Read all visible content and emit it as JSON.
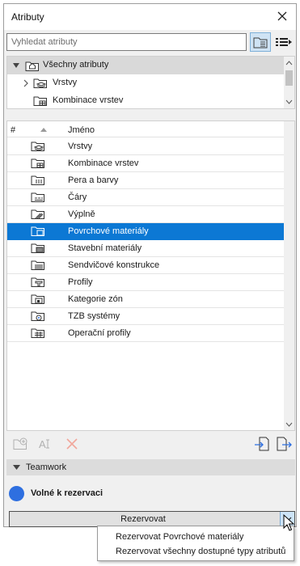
{
  "window": {
    "title": "Atributy"
  },
  "search": {
    "placeholder": "Vyhledat atributy"
  },
  "tree": {
    "items": [
      {
        "label": "Všechny atributy",
        "icon": "house-folder-icon"
      },
      {
        "label": "Vrstvy",
        "icon": "layers-icon"
      },
      {
        "label": "Kombinace vrstev",
        "icon": "layer-combination-icon"
      }
    ]
  },
  "table": {
    "headers": {
      "number": "#",
      "name": "Jméno"
    },
    "rows": [
      {
        "label": "Vrstvy",
        "icon": "layers-icon"
      },
      {
        "label": "Kombinace vrstev",
        "icon": "layer-combination-icon"
      },
      {
        "label": "Pera a barvy",
        "icon": "pens-colors-icon"
      },
      {
        "label": "Čáry",
        "icon": "lines-icon"
      },
      {
        "label": "Výplně",
        "icon": "fills-icon"
      },
      {
        "label": "Povrchové materiály",
        "icon": "surfaces-icon",
        "selected": true
      },
      {
        "label": "Stavební materiály",
        "icon": "building-materials-icon"
      },
      {
        "label": "Sendvičové konstrukce",
        "icon": "composites-icon"
      },
      {
        "label": "Profily",
        "icon": "profiles-icon"
      },
      {
        "label": "Kategorie zón",
        "icon": "zone-categories-icon"
      },
      {
        "label": "TZB systémy",
        "icon": "mep-systems-icon"
      },
      {
        "label": "Operační profily",
        "icon": "operation-profiles-icon"
      }
    ]
  },
  "teamwork": {
    "section_label": "Teamwork",
    "status": "Volné k rezervaci",
    "status_color": "#2e6fe0",
    "reserve_label": "Rezervovat"
  },
  "menu": {
    "items": [
      "Rezervovat Povrchové materiály",
      "Rezervovat všechny dostupné typy atributů"
    ]
  },
  "colors": {
    "selection": "#0c78d4",
    "accent": "#2e6fe0"
  }
}
